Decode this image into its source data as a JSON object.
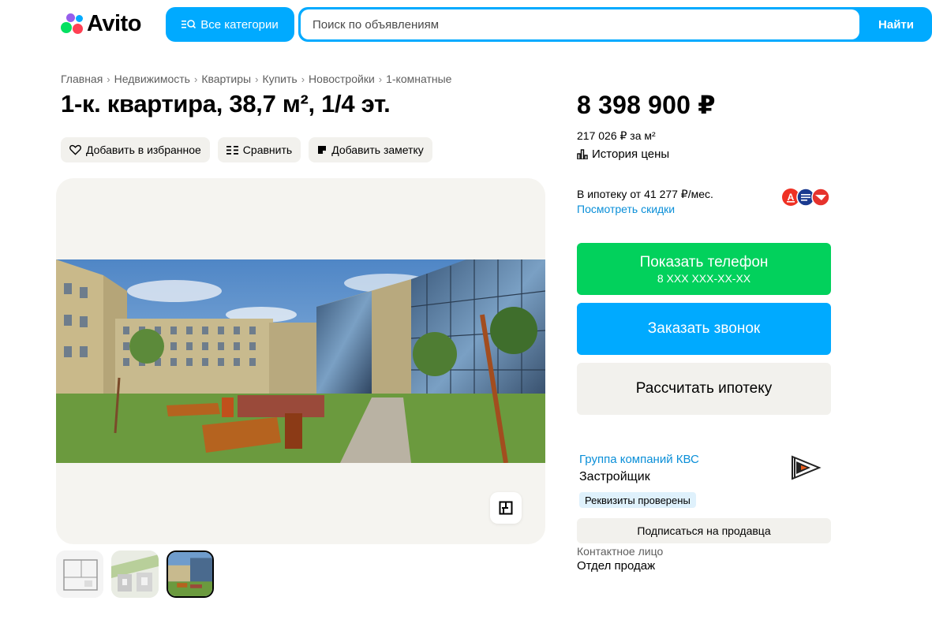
{
  "header": {
    "logo_text": "Avito",
    "categories_button": "Все категории",
    "search_placeholder": "Поиск по объявлениям",
    "search_button": "Найти"
  },
  "breadcrumb": [
    "Главная",
    "Недвижимость",
    "Квартиры",
    "Купить",
    "Новостройки",
    "1-комнатные"
  ],
  "listing": {
    "title": "1-к. квартира, 38,7 м², 1/4 эт.",
    "actions": {
      "favorite": "Добавить в избранное",
      "compare": "Сравнить",
      "note": "Добавить заметку"
    },
    "thumbnails": [
      "floor-plan",
      "site-plan",
      "courtyard-photo"
    ],
    "active_thumbnail": 2
  },
  "price": {
    "value": "8 398 900 ₽",
    "per_m2": "217 026 ₽ за м²",
    "history_label": "История цены"
  },
  "mortgage": {
    "text": "В ипотеку от 41 277 ₽/мес.",
    "discounts_link": "Посмотреть скидки",
    "bank_colors": [
      "#ef3124",
      "#1a3a8f",
      "#e6322c"
    ]
  },
  "buttons": {
    "show_phone": "Показать телефон",
    "phone_masked": "8 XXX XXX-XX-XX",
    "order_call": "Заказать звонок",
    "calc_mortgage": "Рассчитать ипотеку",
    "subscribe": "Подписаться на продавца"
  },
  "seller": {
    "name": "Группа компаний КВС",
    "role": "Застройщик",
    "verified_badge": "Реквизиты проверены",
    "logo_icon": "kvs-logo"
  },
  "contact": {
    "label": "Контактное лицо",
    "value": "Отдел продаж"
  },
  "colors": {
    "accent_blue": "#00aaff",
    "phone_green": "#02d15c",
    "link_blue": "#0a8fd8",
    "neutral_bg": "#f2f1ed"
  }
}
